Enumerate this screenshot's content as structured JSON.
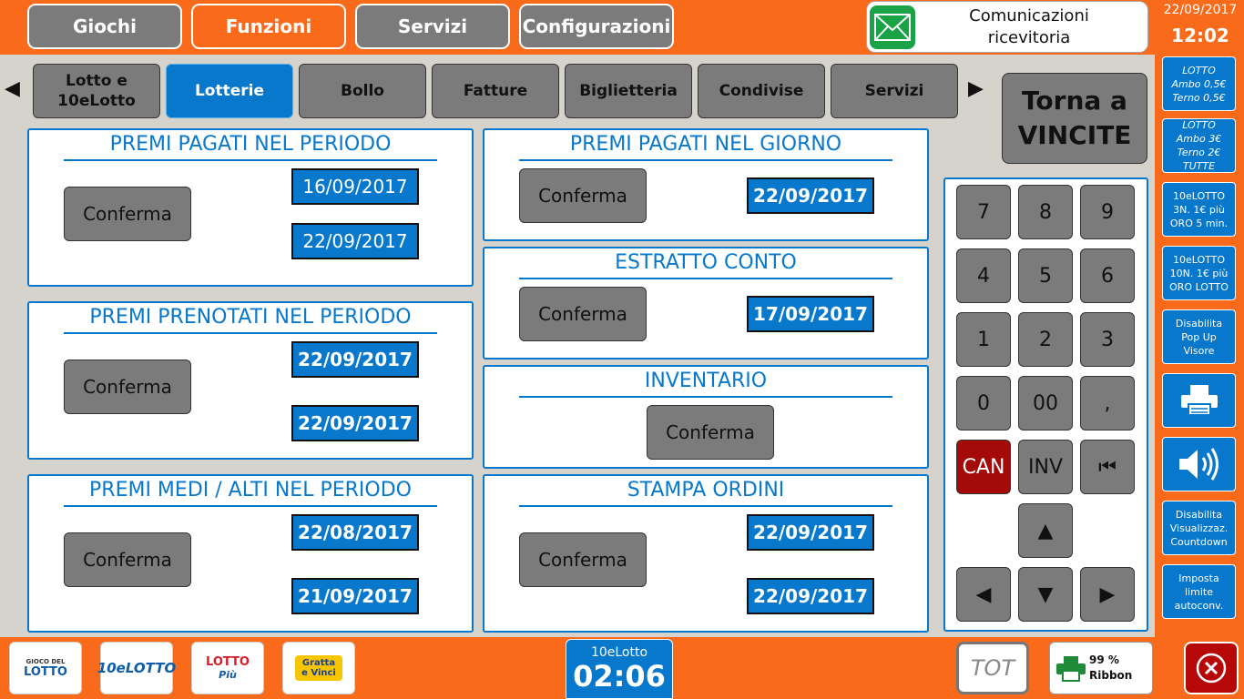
{
  "menu": {
    "items": [
      {
        "label": "Giochi"
      },
      {
        "label": "Funzioni"
      },
      {
        "label": "Servizi"
      },
      {
        "label": "Configurazioni"
      }
    ]
  },
  "comm": {
    "label": "Comunicazioni\nricevitoria"
  },
  "clock": {
    "date": "22/09/2017",
    "time": "12:02"
  },
  "side": {
    "items": [
      {
        "label": "LOTTO\nAmbo 0,5€\nTerno 0,5€"
      },
      {
        "label": "LOTTO\nAmbo 3€\nTerno 2€\nTUTTE"
      },
      {
        "label": "10eLOTTO\n3N. 1€ più\nORO 5 min."
      },
      {
        "label": "10eLOTTO\n10N. 1€ più\nORO LOTTO"
      },
      {
        "label": "Disabilita\nPop Up\nVisore"
      },
      {
        "label": "Disabilita\nVisualizzaz.\nCountdown"
      },
      {
        "label": "Imposta\nlimite\nautoconv."
      }
    ]
  },
  "tabs": {
    "items": [
      {
        "label": "Lotto e\n10eLotto"
      },
      {
        "label": "Lotterie"
      },
      {
        "label": "Bollo"
      },
      {
        "label": "Fatture"
      },
      {
        "label": "Biglietteria"
      },
      {
        "label": "Condivise"
      },
      {
        "label": "Servizi"
      }
    ],
    "prev": "◀",
    "next": "▶"
  },
  "torna": {
    "label": "Torna a\nVINCITE"
  },
  "panels": {
    "confirm_label": "Conferma",
    "pagati_periodo": {
      "title": "PREMI PAGATI NEL PERIODO",
      "date_from": "16/09/2017",
      "date_to": "22/09/2017"
    },
    "prenotati_periodo": {
      "title": "PREMI PRENOTATI NEL PERIODO",
      "date_from": "22/09/2017",
      "date_to": "22/09/2017"
    },
    "medi_alti_periodo": {
      "title": "PREMI MEDI / ALTI NEL PERIODO",
      "date_from": "22/08/2017",
      "date_to": "21/09/2017"
    },
    "pagati_giorno": {
      "title": "PREMI PAGATI NEL GIORNO",
      "date": "22/09/2017"
    },
    "estratto_conto": {
      "title": "ESTRATTO CONTO",
      "date": "17/09/2017"
    },
    "inventario": {
      "title": "INVENTARIO"
    },
    "stampa_ordini": {
      "title": "STAMPA ORDINI",
      "date_from": "22/09/2017",
      "date_to": "22/09/2017"
    }
  },
  "keypad": {
    "keys": [
      "7",
      "8",
      "9",
      "4",
      "5",
      "6",
      "1",
      "2",
      "3",
      "0",
      "00",
      ",",
      "CAN",
      "INV",
      "⏮",
      "▲",
      "◀",
      "▼",
      "▶"
    ]
  },
  "bottom": {
    "logos": [
      {
        "label": "LOTTO",
        "sub": "GIOCO DEL"
      },
      {
        "label": "10eLOTTO"
      },
      {
        "label": "LOTTO",
        "sub": "Più"
      },
      {
        "label": "Gratta e Vinci"
      }
    ],
    "timer_label": "10eLotto",
    "timer_value": "02:06",
    "tot_label": "TOT",
    "ribbon_percent": "99 %",
    "ribbon_label": "Ribbon"
  },
  "colors": {
    "accent_orange": "#f96b1b",
    "accent_blue": "#0778cc",
    "button_gray": "#7b7b7b",
    "cancel_red": "#a50a0a"
  }
}
